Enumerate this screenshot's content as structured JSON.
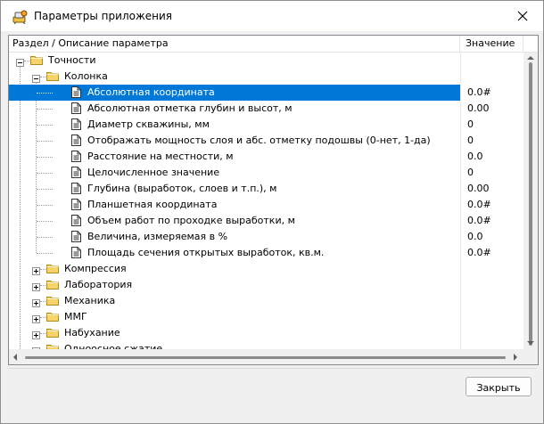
{
  "window": {
    "title": "Параметры приложения",
    "close_tooltip_icon": "close-icon"
  },
  "tree": {
    "header": {
      "col1": "Раздел / Описание параметра",
      "col2": "Значение"
    },
    "rows": [
      {
        "level": 0,
        "type": "folder",
        "expanded": true,
        "label": "Точности",
        "value": ""
      },
      {
        "level": 1,
        "type": "folder",
        "expanded": true,
        "label": "Колонка",
        "value": ""
      },
      {
        "level": 2,
        "type": "param",
        "label": "Абсолютная координата",
        "value": "0.0#",
        "selected": true
      },
      {
        "level": 2,
        "type": "param",
        "label": "Абсолютная отметка глубин и высот, м",
        "value": "0.00"
      },
      {
        "level": 2,
        "type": "param",
        "label": "Диаметр скважины, мм",
        "value": "0"
      },
      {
        "level": 2,
        "type": "param",
        "label": "Отображать мощность слоя и абс. отметку подошвы (0-нет, 1-да)",
        "value": "0"
      },
      {
        "level": 2,
        "type": "param",
        "label": "Расстояние на местности, м",
        "value": "0.0"
      },
      {
        "level": 2,
        "type": "param",
        "label": "Целочисленное значение",
        "value": "0"
      },
      {
        "level": 2,
        "type": "param",
        "label": "Глубина (выработок, слоев и т.п.), м",
        "value": "0.00"
      },
      {
        "level": 2,
        "type": "param",
        "label": "Планшетная координата",
        "value": "0.0#"
      },
      {
        "level": 2,
        "type": "param",
        "label": "Объем работ по проходке выработки, м",
        "value": "0.0#"
      },
      {
        "level": 2,
        "type": "param",
        "label": "Величина, измеряемая в %",
        "value": "0.0"
      },
      {
        "level": 2,
        "type": "param",
        "label": "Площадь сечения открытых выработок, кв.м.",
        "value": "0.0#"
      },
      {
        "level": 1,
        "type": "folder",
        "expanded": false,
        "label": "Компрессия",
        "value": ""
      },
      {
        "level": 1,
        "type": "folder",
        "expanded": false,
        "label": "Лаборатория",
        "value": ""
      },
      {
        "level": 1,
        "type": "folder",
        "expanded": false,
        "label": "Механика",
        "value": ""
      },
      {
        "level": 1,
        "type": "folder",
        "expanded": false,
        "label": "ММГ",
        "value": ""
      },
      {
        "level": 1,
        "type": "folder",
        "expanded": false,
        "label": "Набухание",
        "value": ""
      },
      {
        "level": 1,
        "type": "folder",
        "expanded": false,
        "label": "Одноосное сжатие",
        "value": ""
      }
    ]
  },
  "footer": {
    "close_label": "Закрыть"
  },
  "colors": {
    "selection": "#0078d7",
    "folder": "#f7d46a"
  }
}
